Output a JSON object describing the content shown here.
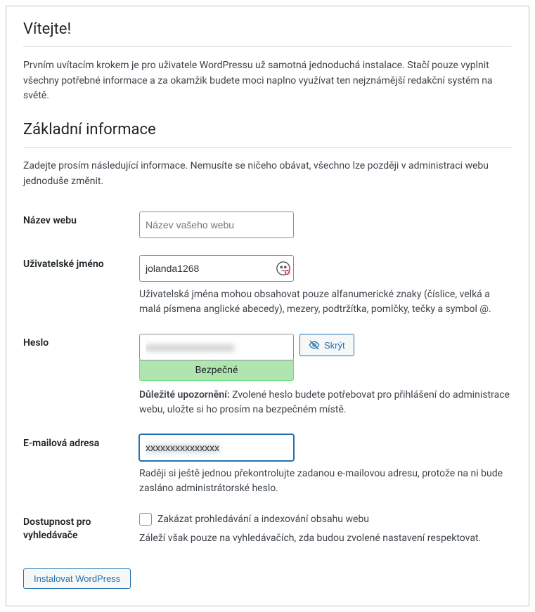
{
  "welcome": {
    "heading": "Vítejte!",
    "intro": "Prvním uvítacím krokem je pro uživatele WordPressu už samotná jednoduchá instalace. Stačí pouze vyplnit všechny potřebné informace a za okamžik budete moci naplno využívat ten nejznámější redakční systém na světě."
  },
  "section": {
    "heading": "Základní informace",
    "lead": "Zadejte prosím následující informace. Nemusíte se ničeho obávat, všechno lze později v administraci webu jednoduše změnit."
  },
  "fields": {
    "site_title": {
      "label": "Název webu",
      "placeholder": "Název vašeho webu",
      "value": ""
    },
    "username": {
      "label": "Uživatelské jméno",
      "value": "jolanda1268",
      "help": "Uživatelská jména mohou obsahovat pouze alfanumerické znaky (číslice, velká a malá písmena anglické abecedy), mezery, podtržítka, pomlčky, tečky a symbol @."
    },
    "password": {
      "label": "Heslo",
      "value": "xxxxxxxxxxxxxxxxxx",
      "strength": "Bezpečné",
      "hide_button": "Skrýt",
      "note_strong": "Důležité upozornění:",
      "note_rest": " Zvolené heslo budete potřebovat pro přihlášení do administrace webu, uložte si ho prosím na bezpečném místě."
    },
    "email": {
      "label": "E-mailová adresa",
      "value": "xxxxxxxxxxxxxxx",
      "help": "Raději si ještě jednou překontrolujte zadanou e-mailovou adresu, protože na ni bude zasláno administrátorské heslo."
    },
    "privacy": {
      "label": "Dostupnost pro vyhledávače",
      "checkbox_label": "Zakázat prohledávání a indexování obsahu webu",
      "help": "Záleží však pouze na vyhledávačích, zda budou zvolené nastavení respektovat."
    }
  },
  "submit": {
    "label": "Instalovat WordPress"
  }
}
